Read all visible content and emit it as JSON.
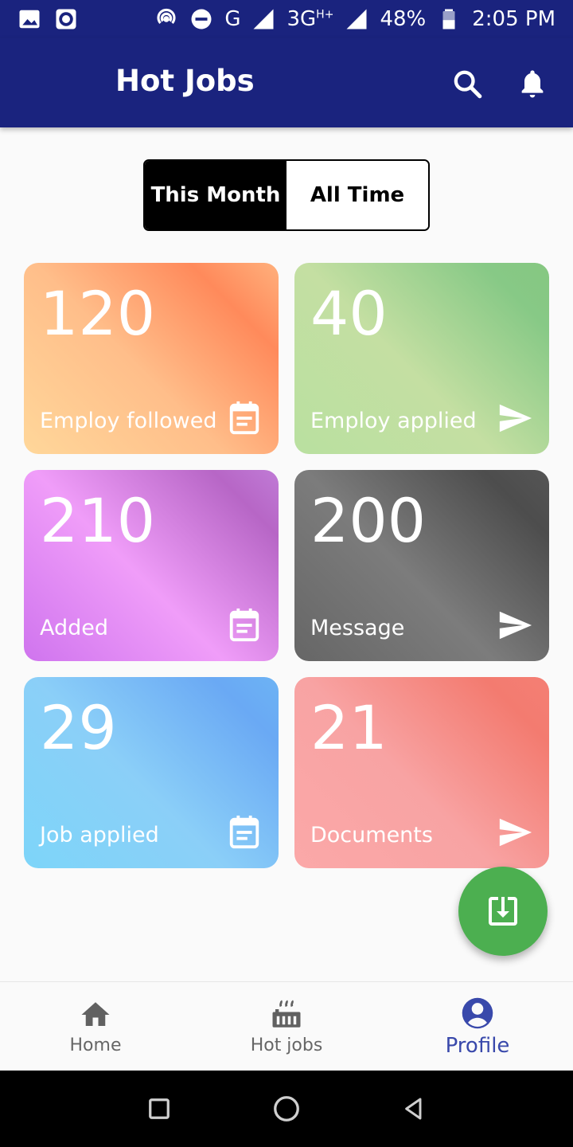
{
  "status_bar": {
    "network_g": "G",
    "network_3g": "3G",
    "network_hplus": "H+",
    "battery": "48%",
    "time": "2:05 PM"
  },
  "app_bar": {
    "title": "Hot Jobs"
  },
  "toggle": {
    "options": [
      "This Month",
      "All Time"
    ],
    "selected": "This Month"
  },
  "cards": [
    {
      "value": "120",
      "label": "Employ followed",
      "icon": "calendar-icon"
    },
    {
      "value": "40",
      "label": "Employ applied",
      "icon": "send-icon"
    },
    {
      "value": "210",
      "label": "Added",
      "icon": "calendar-icon"
    },
    {
      "value": "200",
      "label": "Message",
      "icon": "send-icon"
    },
    {
      "value": "29",
      "label": "Job applied",
      "icon": "calendar-icon"
    },
    {
      "value": "21",
      "label": "Documents",
      "icon": "send-icon"
    }
  ],
  "bottom_nav": {
    "items": [
      {
        "label": "Home",
        "icon": "home-icon"
      },
      {
        "label": "Hot jobs",
        "icon": "hot-jobs-icon"
      },
      {
        "label": "Profile",
        "icon": "profile-icon"
      }
    ],
    "active": "Profile"
  },
  "colors": {
    "app_bar": "#1a237e",
    "fab": "#4caf50",
    "nav_active": "#3949ab"
  }
}
